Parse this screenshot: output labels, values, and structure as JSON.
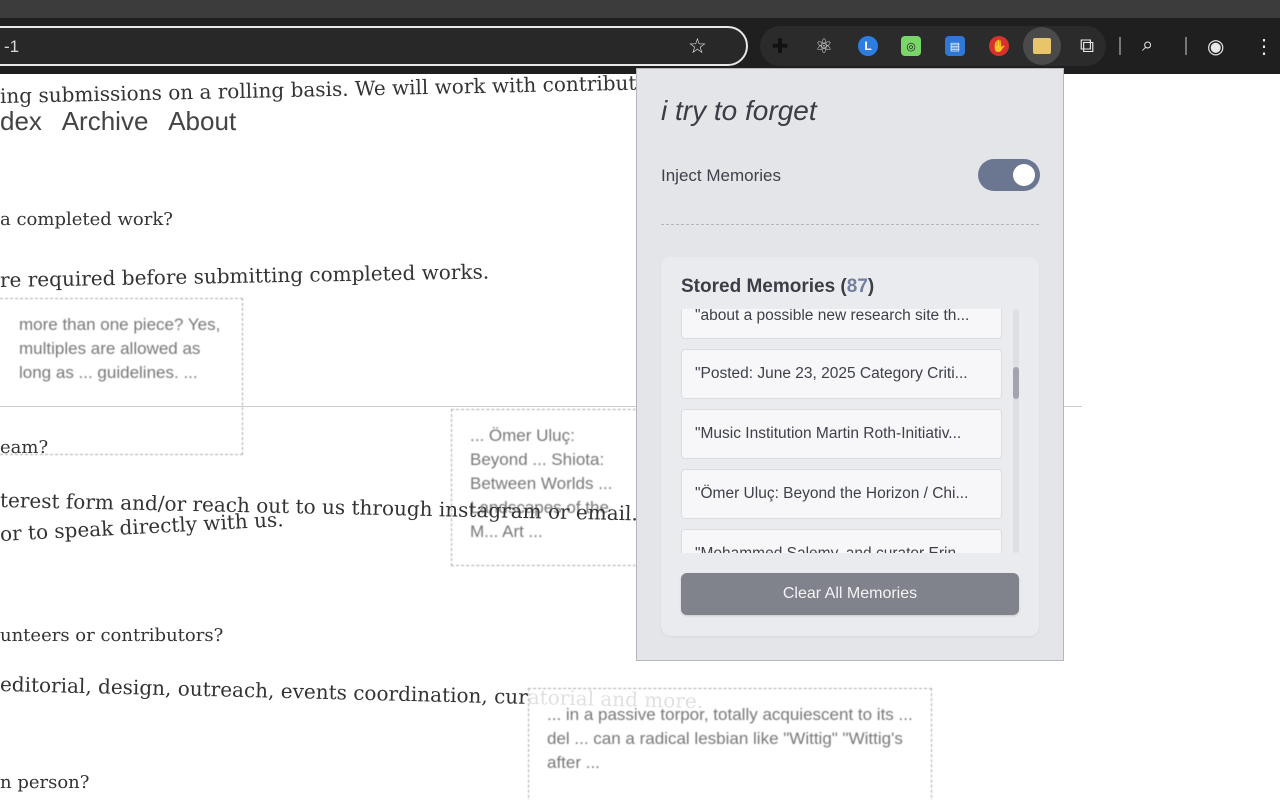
{
  "browser": {
    "address_text": "-1",
    "extensions": [
      "puzzle-black-icon",
      "react-icon",
      "lastpass-icon",
      "evernote-icon",
      "doc-icon",
      "hand-icon",
      "memory-ext-icon",
      "extensions-icon"
    ],
    "colors": {
      "toolbar": "#1f1f1f",
      "accent": "#6b7691"
    }
  },
  "page": {
    "line1": "ing submissions on a rolling basis. We will work with contributors to",
    "nav": [
      "dex",
      "Archive",
      "About"
    ],
    "q1": "a completed work?",
    "a1": "re required before submitting completed works.",
    "box1": "more than one piece? Yes, multiples are allowed as long as ... guidelines. ...",
    "q2": "eam?",
    "a2a": "terest form and/or reach out to us through instagram or email. We'll",
    "a2b": "or to speak directly with us.",
    "box2": "... Ömer Uluç: Beyond ... Shiota: Between Worlds ... Landscapes of the M... Art ...",
    "q3": "unteers or contributors?",
    "a3": "editorial, design, outreach, events coordination, curatorial and more.",
    "box3": "... in a passive torpor, totally acquiescent to its ... del ... can a radical lesbian like \"Wittig\" \"Wittig's after ...",
    "q4": "n person?"
  },
  "popup": {
    "title": "i try to forget",
    "inject_label": "Inject Memories",
    "inject_on": true,
    "stored_label": "Stored Memories (",
    "stored_count": "87",
    "stored_close": ")",
    "memories": [
      "\"about a possible new research site th...",
      "\"Posted: June 23, 2025 Category Criti...",
      "\"Music Institution Martin Roth-Initiativ...",
      "\"Ömer Uluç: Beyond the Horizon / Chi...",
      "\"Mohammed Salemy, and curator Erin..."
    ],
    "clear_label": "Clear All Memories"
  }
}
